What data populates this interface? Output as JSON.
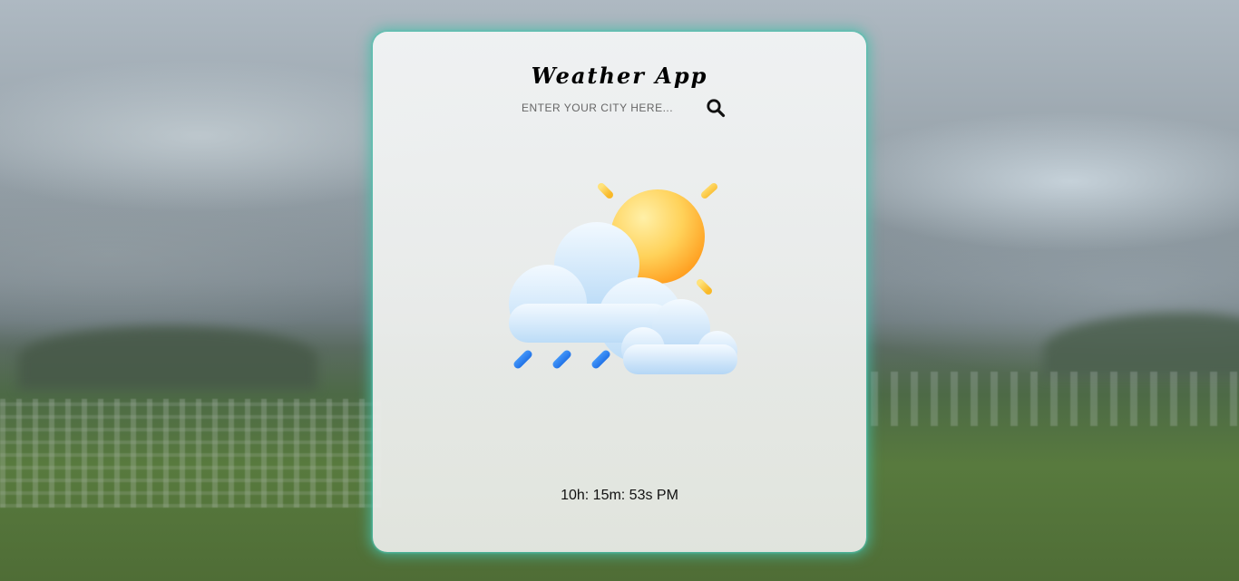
{
  "app": {
    "title": "Weather App"
  },
  "search": {
    "placeholder": "ENTER YOUR CITY HERE...",
    "value": "",
    "icon": "search-icon"
  },
  "weather": {
    "icon": "partly-sunny-rain-icon"
  },
  "clock": {
    "time": "10h: 15m: 53s PM"
  },
  "colors": {
    "card_glow": "#46beaa",
    "sun": "#ffc53a",
    "rain": "#1e7ff0",
    "cloud": "#d8ecfb"
  }
}
